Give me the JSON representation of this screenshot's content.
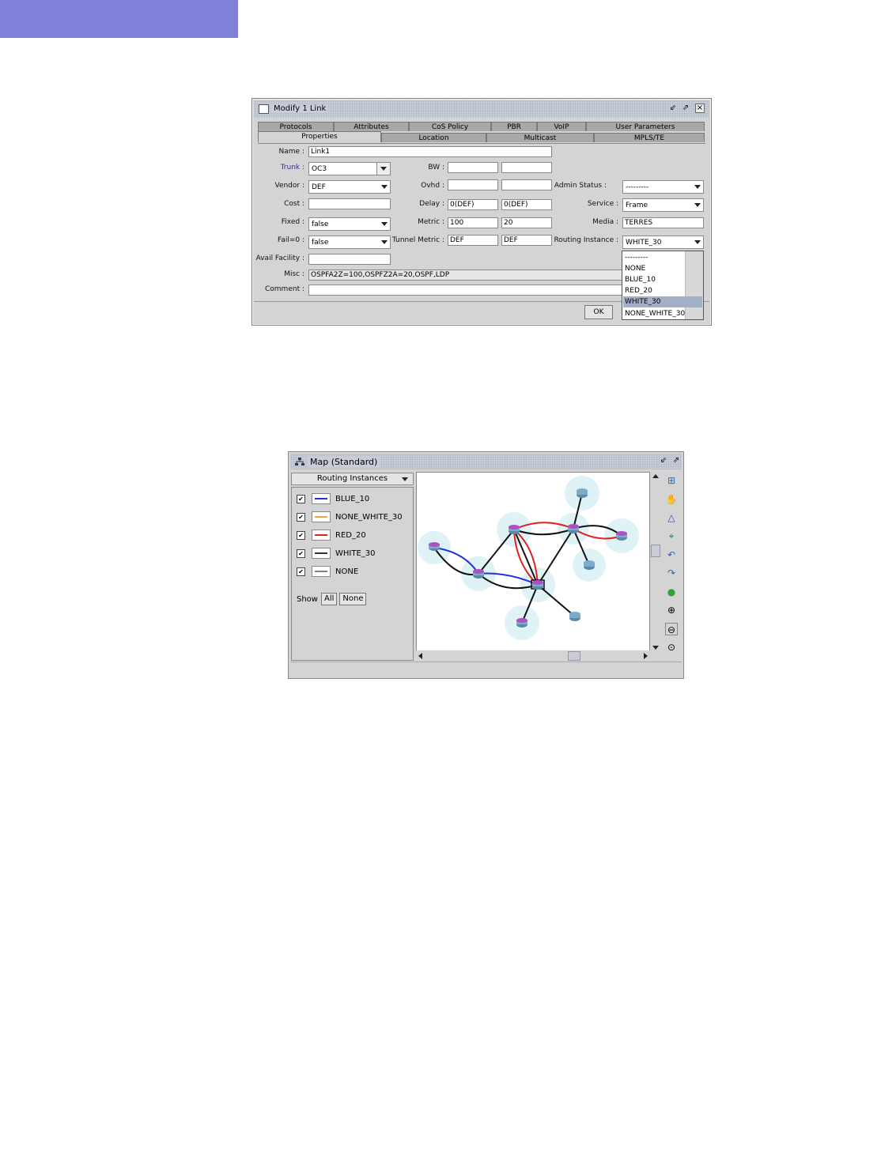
{
  "dialog": {
    "title": "Modify 1 Link",
    "tabs_row1": [
      "Protocols",
      "Attributes",
      "CoS Policy",
      "PBR",
      "VoIP",
      "User Parameters"
    ],
    "tabs_row2": [
      "Properties",
      "Location",
      "Multicast",
      "MPLS/TE"
    ],
    "active_tab": "Properties",
    "labels": {
      "name": "Name :",
      "trunk": "Trunk :",
      "vendor": "Vendor :",
      "cost": "Cost :",
      "fixed": "Fixed :",
      "fail0": "Fail=0 :",
      "avail_facility": "Avail Facility :",
      "misc": "Misc :",
      "comment": "Comment :",
      "bw": "BW :",
      "ovhd": "Ovhd :",
      "delay": "Delay :",
      "metric": "Metric :",
      "tunnel_metric": "Tunnel Metric :",
      "admin_status": "Admin Status :",
      "service": "Service :",
      "media": "Media :",
      "routing_instance": "Routing Instance :"
    },
    "values": {
      "name": "Link1",
      "trunk": "OC3",
      "vendor": "DEF",
      "cost": "",
      "fixed": "false",
      "fail0": "false",
      "avail_facility": "",
      "misc": "OSPFA2Z=100,OSPFZ2A=20,OSPF,LDP",
      "comment": "",
      "bw_a": "",
      "bw_z": "",
      "ovhd_a": "",
      "ovhd_z": "",
      "delay_a": "0(DEF)",
      "delay_z": "0(DEF)",
      "metric_a": "100",
      "metric_z": "20",
      "tunnel_metric_a": "DEF",
      "tunnel_metric_z": "DEF",
      "admin_status": "---------",
      "service": "Frame",
      "media": "TERRES",
      "routing_instance": "WHITE_30"
    },
    "routing_options": [
      "---------",
      "NONE",
      "BLUE_10",
      "RED_20",
      "WHITE_30",
      "NONE_WHITE_30"
    ],
    "selected_option": "WHITE_30",
    "ok_label": "OK"
  },
  "map": {
    "title": "Map (Standard)",
    "dropdown": "Routing Instances",
    "instances": [
      {
        "name": "BLUE_10",
        "color": "#2030e0",
        "checked": true
      },
      {
        "name": "NONE_WHITE_30",
        "color": "#f0a040",
        "checked": true
      },
      {
        "name": "RED_20",
        "color": "#e02020",
        "checked": true
      },
      {
        "name": "WHITE_30",
        "color": "#303030",
        "checked": true
      },
      {
        "name": "NONE",
        "color": "#808080",
        "checked": true
      }
    ],
    "show_label": "Show",
    "show_all": "All",
    "show_none": "None",
    "tools": [
      "export-icon",
      "hand-icon",
      "node-layout-icon",
      "layout-icon",
      "undo-icon",
      "redo-icon",
      "globe-icon",
      "zoom-in-icon",
      "zoom-out-icon",
      "zoom-fit-icon"
    ]
  }
}
